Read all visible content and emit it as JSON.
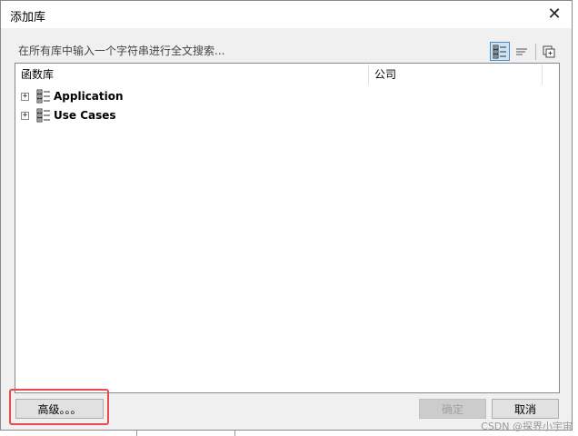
{
  "window": {
    "title": "添加库",
    "close_glyph": "✕"
  },
  "search": {
    "placeholder": "在所有库中输入一个字符串进行全文搜索..."
  },
  "toolbar": {
    "view_buttons": [
      {
        "icon": "tree-view-icon",
        "active": true
      },
      {
        "icon": "list-view-icon",
        "active": false
      },
      {
        "icon": "copy-icon",
        "active": false
      }
    ]
  },
  "table": {
    "columns": [
      "函数库",
      "公司"
    ],
    "rows": [
      {
        "label": "Application",
        "company": "",
        "expander": "+",
        "icon": "library-icon"
      },
      {
        "label": "Use Cases",
        "company": "",
        "expander": "+",
        "icon": "library-icon"
      }
    ]
  },
  "buttons": {
    "advanced_label": "高级。。。",
    "ok_label": "确定",
    "ok_disabled": true,
    "cancel_label": "取消"
  },
  "highlight": {
    "color": "#e84b4b"
  },
  "watermark": {
    "text": "CSDN @探界小宇宙"
  }
}
